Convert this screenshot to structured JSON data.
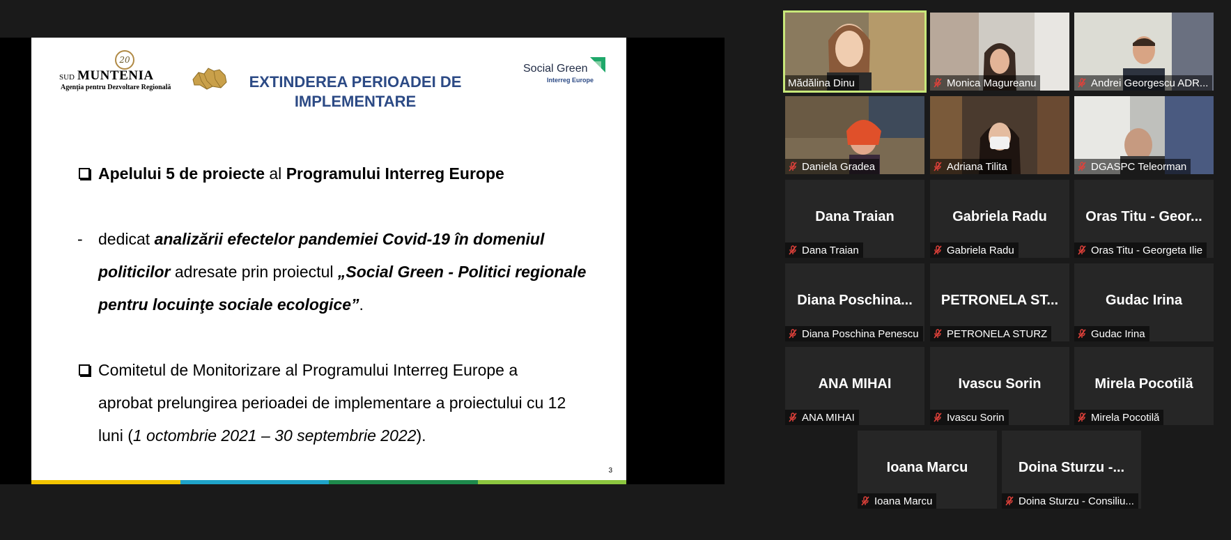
{
  "slide": {
    "logo_left_seal": "20",
    "logo_left_sud": "SUD",
    "logo_left_brand": "MUNTENIA",
    "logo_left_tagline": "Agenţia pentru Dezvoltare Regională",
    "logo_right_name": "Social Green",
    "logo_right_sub": "Interreg Europe",
    "title_line1": "EXTINDEREA PERIOADEI DE",
    "title_line2": "IMPLEMENTARE",
    "bullet1": {
      "a": "Apelului 5 de proiecte",
      "b": " al ",
      "c": "Programului Interreg Europe"
    },
    "dash": "-",
    "sub1": {
      "a": "dedicat ",
      "b": "analizării efectelor pandemiei Covid-19 în domeniul",
      "c": "politicilor",
      "d": " adresate prin proiectul ",
      "e": "„Social Green - Politici regionale",
      "f": "pentru locuinţe sociale ecologice”",
      "g": "."
    },
    "bullet2": {
      "a": "Comitetul de Monitorizare al Programului Interreg Europe a",
      "b": "aprobat prelungirea perioadei de implementare a proiectului cu 12",
      "c": "luni (",
      "d": "1 octombrie 2021 – 30 septembrie 2022",
      "e": ")."
    },
    "page_number": "3",
    "footer_colors": [
      "#f2c400",
      "#1fa3c9",
      "#1e8a4c",
      "#8cc63f"
    ]
  },
  "participants": [
    {
      "name": "Mădălina Dinu",
      "video": true,
      "muted": false,
      "active": true
    },
    {
      "name": "Monica Magureanu",
      "video": true,
      "muted": true
    },
    {
      "name": "Andrei Georgescu ADR...",
      "video": true,
      "muted": true
    },
    {
      "name": "Daniela Gradea",
      "video": true,
      "muted": true
    },
    {
      "name": "Adriana Tilita",
      "video": true,
      "muted": true
    },
    {
      "name": "DGASPC Teleorman",
      "video": true,
      "muted": true
    },
    {
      "name": "Dana Traian",
      "display": "Dana Traian",
      "video": false,
      "muted": true
    },
    {
      "name": "Gabriela Radu",
      "display": "Gabriela Radu",
      "video": false,
      "muted": true
    },
    {
      "name": "Oras Titu - Georgeta Ilie",
      "display": "Oras Titu - Geor...",
      "video": false,
      "muted": true
    },
    {
      "name": "Diana Poschina Penescu",
      "display": "Diana Poschina...",
      "video": false,
      "muted": true
    },
    {
      "name": "PETRONELA STURZ",
      "display": "PETRONELA ST...",
      "video": false,
      "muted": true
    },
    {
      "name": "Gudac Irina",
      "display": "Gudac Irina",
      "video": false,
      "muted": true
    },
    {
      "name": "ANA MIHAI",
      "display": "ANA MIHAI",
      "video": false,
      "muted": true
    },
    {
      "name": "Ivascu Sorin",
      "display": "Ivascu Sorin",
      "video": false,
      "muted": true
    },
    {
      "name": "Mirela Pocotilă",
      "display": "Mirela Pocotilă",
      "video": false,
      "muted": true
    },
    {
      "name": "Ioana Marcu",
      "display": "Ioana Marcu",
      "video": false,
      "muted": true
    },
    {
      "name": "Doina Sturzu - Consiliu...",
      "display": "Doina Sturzu -...",
      "video": false,
      "muted": true
    }
  ],
  "colors": {
    "active_speaker": "#c8e87a",
    "muted_icon": "#e0413a",
    "slide_title": "#2c4a85"
  }
}
